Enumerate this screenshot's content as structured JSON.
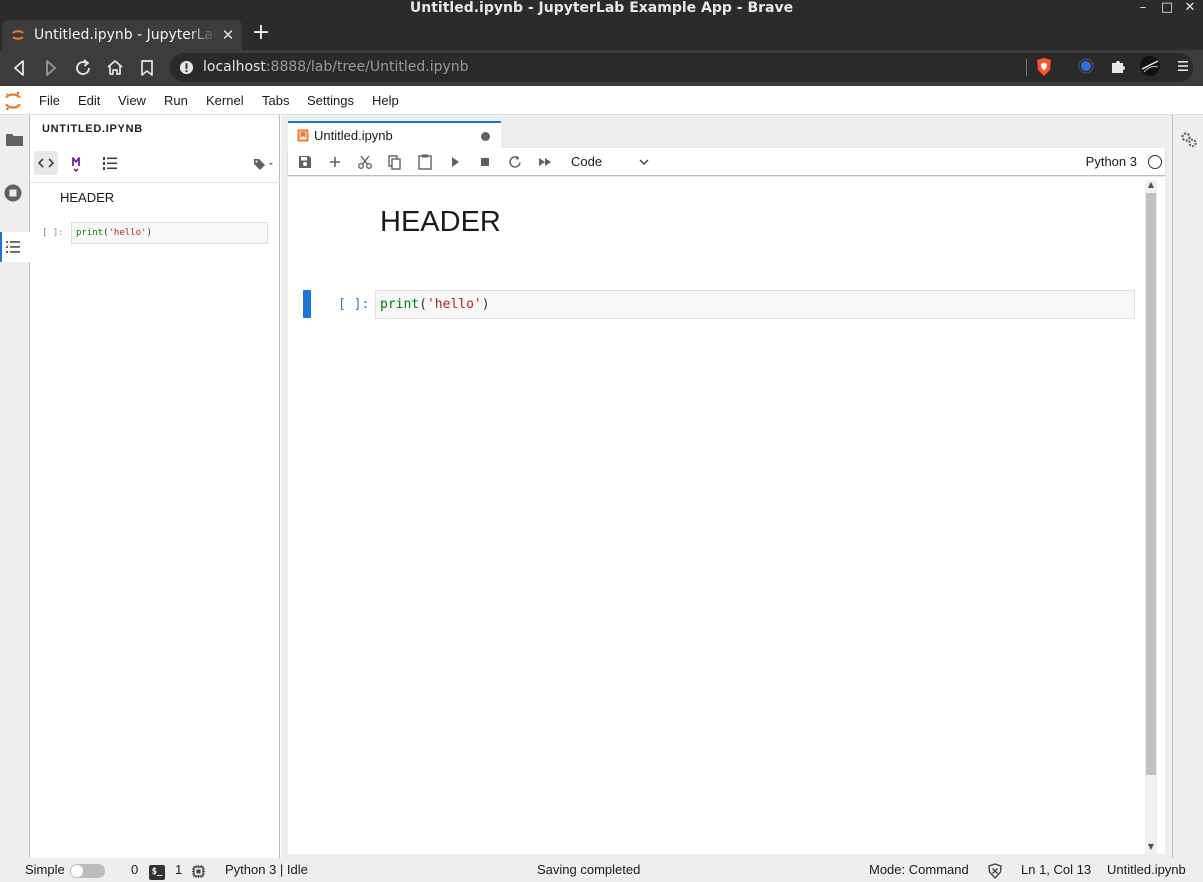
{
  "window": {
    "title": "Untitled.ipynb - JupyterLab Example App - Brave",
    "minimize": "–",
    "maximize": "□",
    "close": "✕"
  },
  "browser": {
    "tab_title": "Untitled.ipynb - JupyterLab Example App",
    "tab_close": "✕",
    "new_tab": "+",
    "url_host": "localhost",
    "url_rest": ":8888/lab/tree/Untitled.ipynb"
  },
  "menu": {
    "items": [
      "File",
      "Edit",
      "View",
      "Run",
      "Kernel",
      "Tabs",
      "Settings",
      "Help"
    ]
  },
  "toc": {
    "title": "UNTITLED.IPYNB",
    "heading": "HEADER",
    "prompt": "[ ]:",
    "code_fn": "print",
    "code_open": "(",
    "code_str": "'hello'",
    "code_close": ")"
  },
  "notebook": {
    "tab_label": "Untitled.ipynb",
    "cell_type": "Code",
    "kernel_name": "Python 3",
    "markdown_heading": "HEADER",
    "input_prompt": "[ ]:",
    "code_fn": "print",
    "code_open": "(",
    "code_str": "'hello'",
    "code_close": ")"
  },
  "status": {
    "mode_simple": "Simple",
    "terminals": "0",
    "kernels": "1",
    "kernel_status": "Python 3 | Idle",
    "message": "Saving completed",
    "mode": "Mode: Command",
    "cursor": "Ln 1, Col 13",
    "file": "Untitled.ipynb"
  },
  "colors": {
    "accent": "#1976d2",
    "jupyter_orange": "#f37726",
    "brave_orange": "#fb542b"
  }
}
